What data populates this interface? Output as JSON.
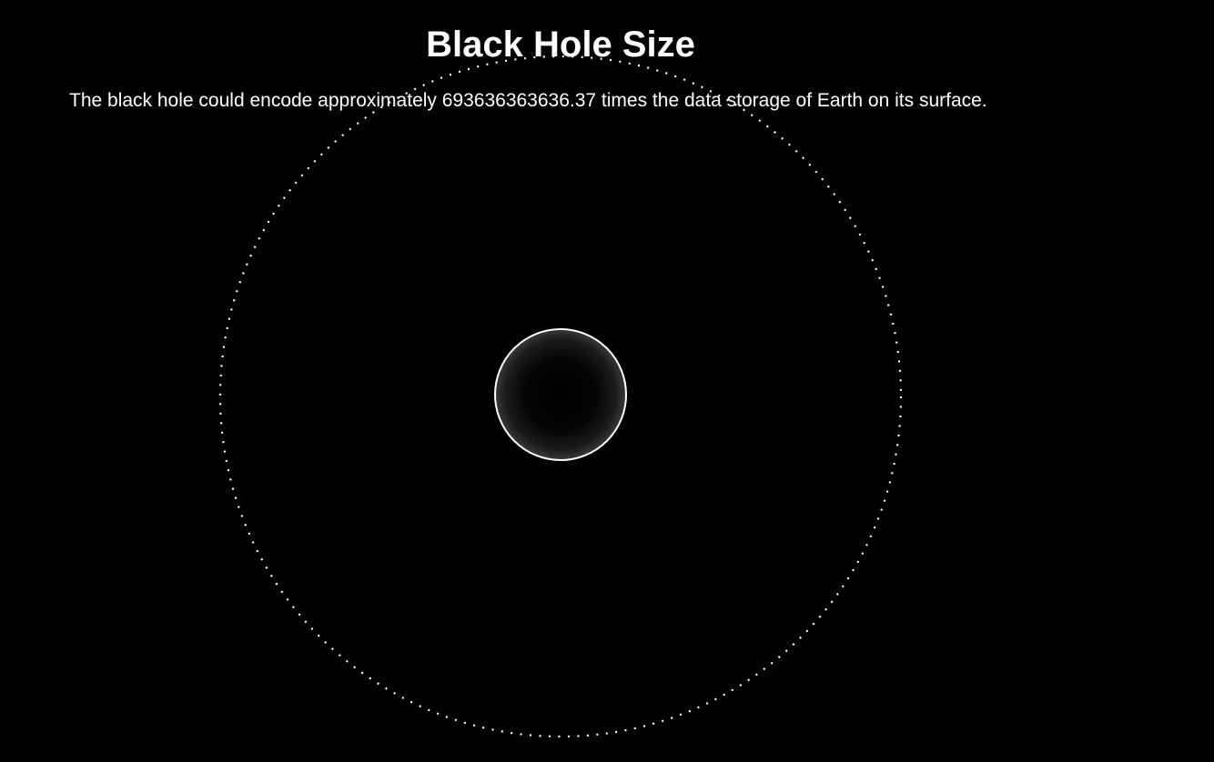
{
  "page": {
    "title": "Black Hole Size",
    "description": "The black hole could encode approximately 693636363636.37 times the data storage of Earth on its surface."
  },
  "colors": {
    "background": "#000000",
    "text": "#ffffff",
    "outline": "#ffffff",
    "glow": "#3a3a3a"
  },
  "icons": {
    "event_horizon": "black-hole-icon",
    "dotted_ring": "dotted-orbit-ring"
  }
}
